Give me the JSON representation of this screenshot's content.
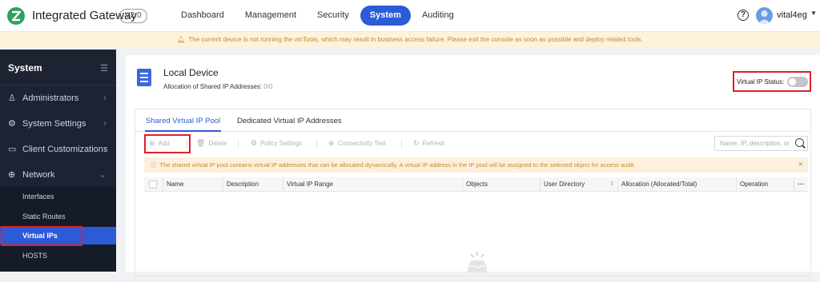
{
  "app": {
    "title": "Integrated Gateway",
    "version": "V2.0",
    "nav": [
      "Dashboard",
      "Management",
      "Security",
      "System",
      "Auditing"
    ],
    "active_nav": "System",
    "user": "vital4eg"
  },
  "warning": "The current device is not running the vmTools, which may result in business access failure. Please exit the console as soon as possible and deploy related tools.",
  "sidebar": {
    "title": "System",
    "items": [
      {
        "label": "Administrators",
        "icon": "user-icon"
      },
      {
        "label": "System Settings",
        "icon": "gear-icon"
      },
      {
        "label": "Client Customizations",
        "icon": "monitor-icon"
      },
      {
        "label": "Network",
        "icon": "globe-icon"
      }
    ],
    "subitems": [
      "Interfaces",
      "Static Routes",
      "Virtual IPs",
      "HOSTS"
    ],
    "active_sub": "Virtual IPs"
  },
  "device": {
    "title": "Local Device",
    "alloc_label": "Allocation of Shared IP Addresses:",
    "alloc_value": "0/0",
    "vip_status_label": "Virtual IP Status:"
  },
  "tabs": [
    "Shared Virtual IP Pool",
    "Dedicated Virtual IP Addresses"
  ],
  "toolbar": {
    "add": "Add",
    "delete": "Delete",
    "policy": "Policy Settings",
    "connectivity": "Connectivity Test",
    "refresh": "Refresh",
    "search_placeholder": "Name, IP, description, or"
  },
  "info": "The shared virtual IP pool contains virtual IP addresses that can be allocated dynamically. A virtual IP address in the IP pool will be assigned to the selected object for access audit.",
  "table": {
    "columns": [
      "Name",
      "Description",
      "Virtual IP Range",
      "Objects",
      "User Directory",
      "Allocation (Allocated/Total)",
      "Operation"
    ]
  },
  "colors": {
    "accent": "#2b5bd7",
    "sidebar_bg": "#1d2333",
    "highlight_red": "#e0202a",
    "warning_text": "#c48b2a"
  }
}
